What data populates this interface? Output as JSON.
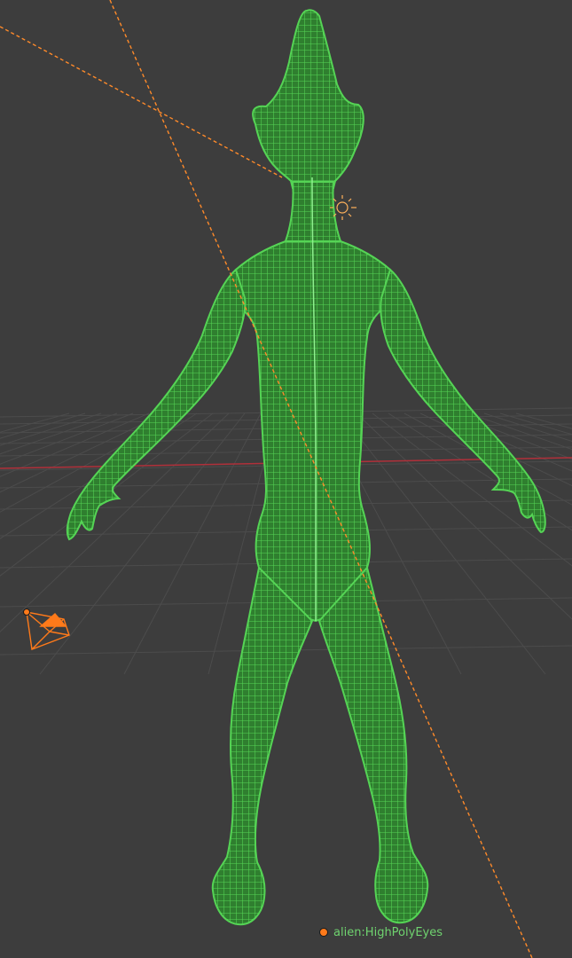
{
  "viewport": {
    "background_color": "#3d3d3d",
    "grid_color": "#4c4c4c",
    "x_axis_color": "#b0303a",
    "mesh_color": "#4cc94c",
    "mesh_fill_color": "#3c9e3c",
    "selection_color": "#ff7a1a",
    "label_color": "#6fd36f"
  },
  "scene": {
    "object_name": "alien:HighPolyEyes",
    "object_icon": "mesh-wireframe-icon",
    "camera_icon": "camera-object-icon",
    "lamp_icon": "sun-lamp-icon"
  }
}
